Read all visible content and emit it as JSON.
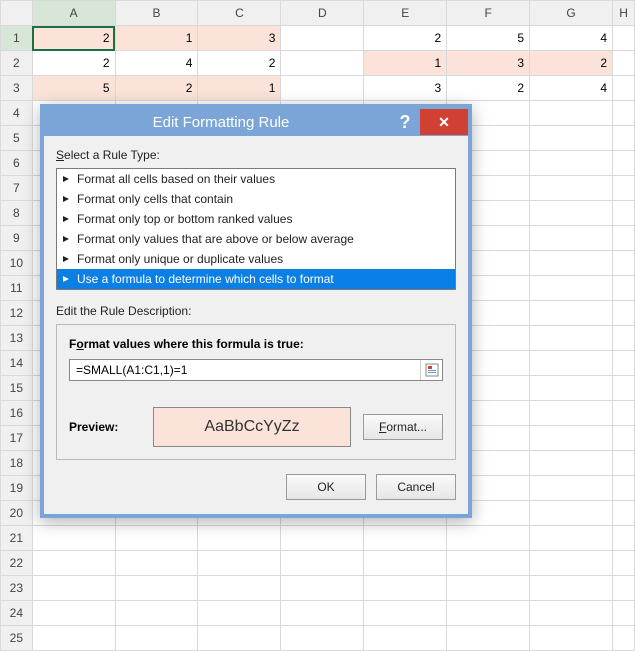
{
  "columns": [
    "A",
    "B",
    "C",
    "D",
    "E",
    "F",
    "G",
    "H"
  ],
  "rows": [
    "1",
    "2",
    "3",
    "4",
    "5",
    "6",
    "7",
    "8",
    "9",
    "10",
    "11",
    "12",
    "13",
    "14",
    "15",
    "16",
    "17",
    "18",
    "19",
    "20",
    "21",
    "22",
    "23",
    "24",
    "25"
  ],
  "cells": {
    "r1": {
      "A": "2",
      "B": "1",
      "C": "3",
      "E": "2",
      "F": "5",
      "G": "4"
    },
    "r2": {
      "A": "2",
      "B": "4",
      "C": "2",
      "E": "1",
      "F": "3",
      "G": "2"
    },
    "r3": {
      "A": "5",
      "B": "2",
      "C": "1",
      "E": "3",
      "F": "2",
      "G": "4"
    }
  },
  "dialog": {
    "title": "Edit Formatting Rule",
    "help_glyph": "?",
    "close_glyph": "✕",
    "select_label": "Select a Rule Type:",
    "rule_types": [
      "Format all cells based on their values",
      "Format only cells that contain",
      "Format only top or bottom ranked values",
      "Format only values that are above or below average",
      "Format only unique or duplicate values",
      "Use a formula to determine which cells to format"
    ],
    "selected_rule_index": 5,
    "edit_label": "Edit the Rule Description:",
    "formula_label": "Format values where this formula is true:",
    "formula_value": "=SMALL(A1:C1,1)=1",
    "preview_label": "Preview:",
    "preview_text": "AaBbCcYyZz",
    "format_button": "Format...",
    "ok_button": "OK",
    "cancel_button": "Cancel"
  }
}
